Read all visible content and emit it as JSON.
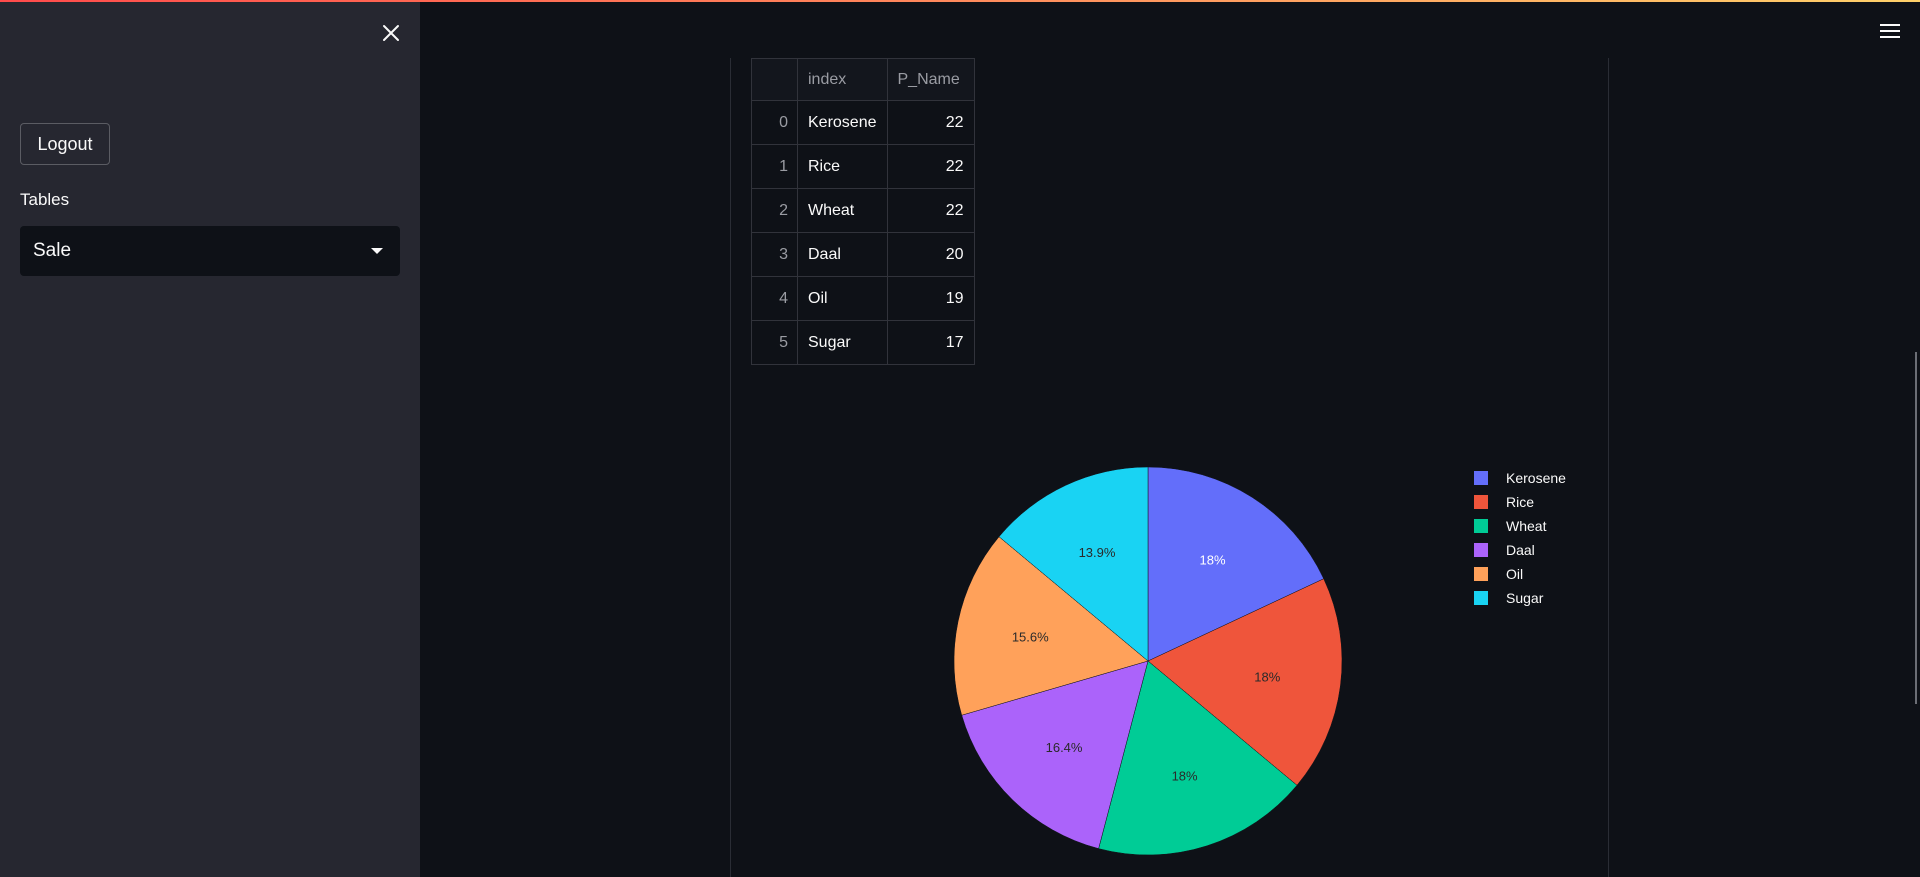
{
  "sidebar": {
    "logout_label": "Logout",
    "tables_label": "Tables",
    "selected_table": "Sale"
  },
  "icons": {
    "close": "close-icon",
    "menu": "hamburger-menu-icon",
    "dropdown": "caret-down-icon"
  },
  "table": {
    "columns": [
      "",
      "index",
      "P_Name"
    ],
    "rows": [
      {
        "row_index": "0",
        "index": "Kerosene",
        "p_name": "22"
      },
      {
        "row_index": "1",
        "index": "Rice",
        "p_name": "22"
      },
      {
        "row_index": "2",
        "index": "Wheat",
        "p_name": "22"
      },
      {
        "row_index": "3",
        "index": "Daal",
        "p_name": "20"
      },
      {
        "row_index": "4",
        "index": "Oil",
        "p_name": "19"
      },
      {
        "row_index": "5",
        "index": "Sugar",
        "p_name": "17"
      }
    ]
  },
  "chart_data": {
    "type": "pie",
    "categories": [
      "Kerosene",
      "Rice",
      "Wheat",
      "Daal",
      "Oil",
      "Sugar"
    ],
    "values": [
      22,
      22,
      22,
      20,
      19,
      17
    ],
    "percent_labels": [
      "18%",
      "18%",
      "18%",
      "16.4%",
      "15.6%",
      "13.9%"
    ],
    "colors": [
      "#636efa",
      "#ef553b",
      "#00cc96",
      "#ab63fa",
      "#ffa15a",
      "#19d3f3"
    ],
    "legend_placement": "right",
    "direction": "counterclockwise",
    "start": "top"
  },
  "colors": {
    "background": "#0e1117",
    "sidebar": "#262730",
    "text": "#fafafa"
  }
}
